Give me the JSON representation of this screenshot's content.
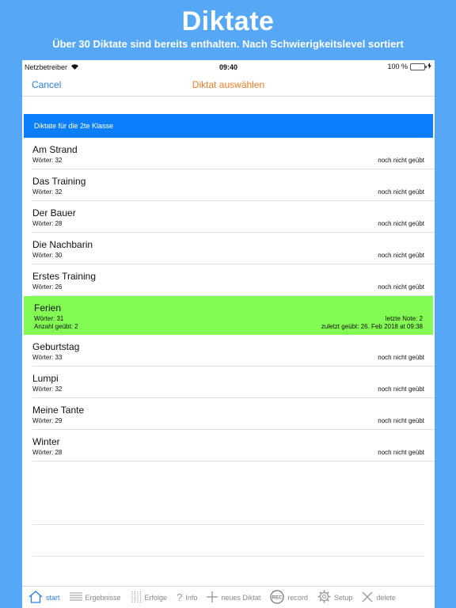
{
  "promo": {
    "title": "Diktate",
    "subtitle": "Über 30 Diktate sind bereits enthalten. Nach Schwierigkeitslevel sortiert"
  },
  "status_bar": {
    "carrier": "Netzbetreiber",
    "time": "09:40",
    "battery": "100 %"
  },
  "nav": {
    "cancel": "Cancel",
    "title": "Diktat auswählen"
  },
  "section": {
    "header": "Diktate für die 2te Klasse"
  },
  "items": [
    {
      "title": "Am Strand",
      "words": "Wörter: 32",
      "status": "noch nicht geübt"
    },
    {
      "title": "Das Training",
      "words": "Wörter: 32",
      "status": "noch nicht geübt"
    },
    {
      "title": "Der Bauer",
      "words": "Wörter: 28",
      "status": "noch nicht geübt"
    },
    {
      "title": "Die Nachbarin",
      "words": "Wörter: 30",
      "status": "noch nicht geübt"
    },
    {
      "title": "Erstes Training",
      "words": "Wörter: 26",
      "status": "noch nicht geübt"
    },
    {
      "title": "Ferien",
      "words": "Wörter: 31",
      "status": "letzte Note: 2",
      "extra_left": "Anzahl geübt: 2",
      "extra_right": "zuletzt geübt: 26. Feb 2018 at 09:38"
    },
    {
      "title": "Geburtstag",
      "words": "Wörter: 33",
      "status": "noch nicht geübt"
    },
    {
      "title": "Lumpi",
      "words": "Wörter: 32",
      "status": "noch nicht geübt"
    },
    {
      "title": "Meine Tante",
      "words": "Wörter: 29",
      "status": "noch nicht geübt"
    },
    {
      "title": "Winter",
      "words": "Wörter: 28",
      "status": "noch nicht geübt"
    }
  ],
  "tabs": [
    {
      "label": "start",
      "icon": "home-icon"
    },
    {
      "label": "Ergebnisse",
      "icon": "list-icon"
    },
    {
      "label": "Erfolge",
      "icon": "grid-icon"
    },
    {
      "label": "Info",
      "icon": "question-icon"
    },
    {
      "label": "neues Diktat",
      "icon": "plus-icon"
    },
    {
      "label": "record",
      "icon": "rec-icon",
      "icon_text": "REC"
    },
    {
      "label": "Setup",
      "icon": "gear-icon"
    },
    {
      "label": "delete",
      "icon": "x-icon"
    }
  ],
  "colors": {
    "background": "#56a8f7",
    "section_header": "#0b7efb",
    "highlight": "#83fb54",
    "nav_title": "#f07d2a",
    "link": "#2a7de1"
  }
}
